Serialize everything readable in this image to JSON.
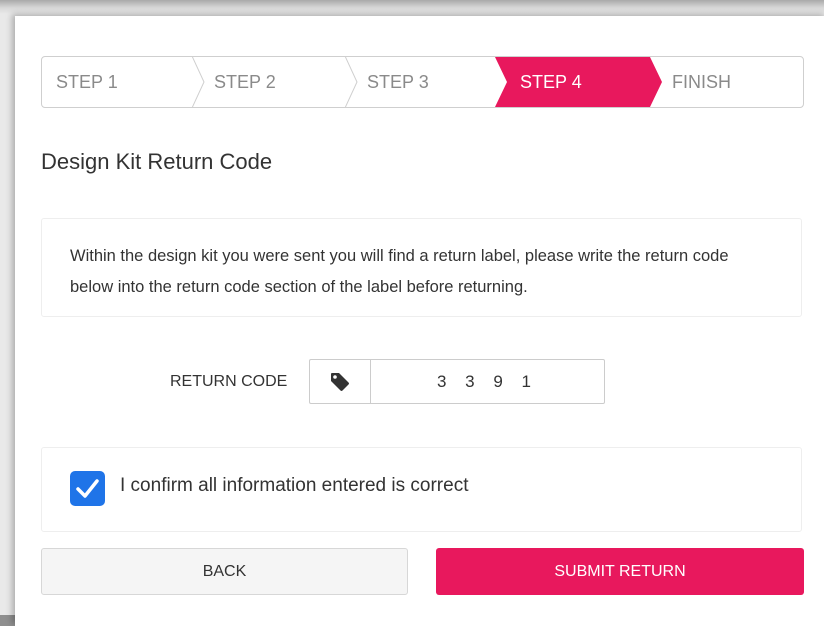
{
  "stepper": {
    "steps": [
      "STEP 1",
      "STEP 2",
      "STEP 3",
      "STEP 4",
      "FINISH"
    ],
    "active_index": 3,
    "active_color": "#e8185d"
  },
  "page": {
    "title": "Design Kit Return Code",
    "instructions": "Within the design kit you were sent you will find a return label, please write the return code below into the return code section of the label before returning."
  },
  "return_code": {
    "label": "RETURN CODE",
    "icon": "tag-icon",
    "value": "3391",
    "display": "3 3 9 1"
  },
  "confirm": {
    "checked": true,
    "label": "I confirm all information entered is correct",
    "check_color": "#1f74e8"
  },
  "actions": {
    "back_label": "BACK",
    "submit_label": "SUBMIT RETURN",
    "submit_color": "#e8185d"
  }
}
